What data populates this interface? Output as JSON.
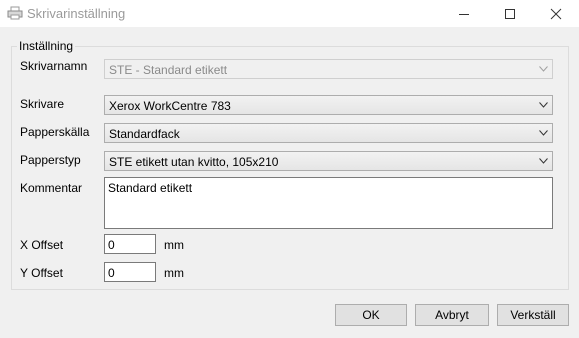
{
  "window": {
    "title": "Skrivarinställning"
  },
  "group": {
    "legend": "Inställning"
  },
  "fields": {
    "skrivarnamn": {
      "label": "Skrivarnamn",
      "value": "STE - Standard etikett"
    },
    "skrivare": {
      "label": "Skrivare",
      "value": "Xerox WorkCentre 783"
    },
    "papperskalla": {
      "label": "Papperskälla",
      "value": "Standardfack"
    },
    "papperstyp": {
      "label": "Papperstyp",
      "value": "STE etikett utan kvitto, 105x210"
    },
    "kommentar": {
      "label": "Kommentar",
      "value": "Standard etikett"
    },
    "x_offset": {
      "label": "X Offset",
      "value": "0",
      "unit": "mm"
    },
    "y_offset": {
      "label": "Y Offset",
      "value": "0",
      "unit": "mm"
    }
  },
  "buttons": {
    "ok": "OK",
    "cancel": "Avbryt",
    "apply": "Verkställ"
  },
  "icons": {
    "app": "printer-icon",
    "minimize": "minimize-icon",
    "maximize": "maximize-icon",
    "close": "close-icon"
  }
}
